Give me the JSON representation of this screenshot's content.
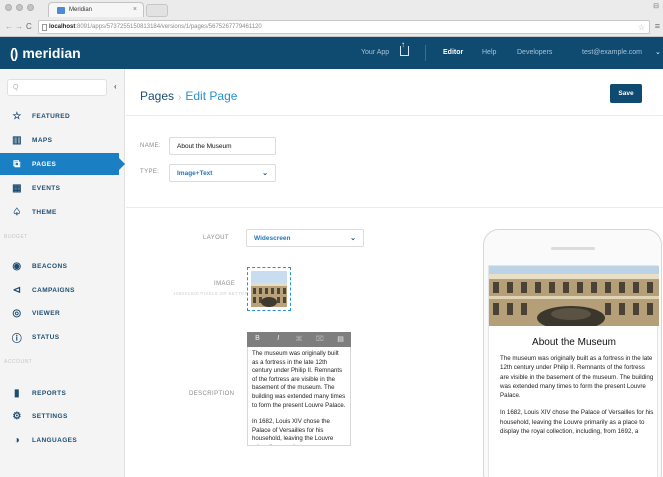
{
  "browser": {
    "tab_title": "Meridian",
    "url_host": "localhost",
    "url_path": ":8091/apps/5737255150813184/versions/1/pages/5675267779461120"
  },
  "header": {
    "brand": "meridian",
    "nav": {
      "your_app": "Your App",
      "editor": "Editor",
      "help": "Help",
      "developers": "Developers",
      "account": "test@example.com"
    }
  },
  "sidebar": {
    "search_placeholder": "Q",
    "items": [
      {
        "label": "FEATURED",
        "icon": "star-icon"
      },
      {
        "label": "MAPS",
        "icon": "map-icon"
      },
      {
        "label": "PAGES",
        "icon": "pages-icon"
      },
      {
        "label": "EVENTS",
        "icon": "calendar-icon"
      },
      {
        "label": "THEME",
        "icon": "paint-icon"
      }
    ],
    "section_budget": "BUDGET",
    "budget_items": [
      {
        "label": "BEACONS",
        "icon": "location-pin-icon"
      },
      {
        "label": "CAMPAIGNS",
        "icon": "megaphone-icon"
      },
      {
        "label": "VIEWER",
        "icon": "eye-icon"
      },
      {
        "label": "STATUS",
        "icon": "info-icon"
      }
    ],
    "section_account": "ACCOUNT",
    "account_items": [
      {
        "label": "REPORTS",
        "icon": "bar-chart-icon"
      },
      {
        "label": "SETTINGS",
        "icon": "gear-icon"
      },
      {
        "label": "LANGUAGES",
        "icon": "languages-icon"
      }
    ]
  },
  "page": {
    "breadcrumb_root": "Pages",
    "breadcrumb_sep": "›",
    "breadcrumb_current": "Edit Page",
    "save_label": "Save",
    "name_label": "NAME:",
    "name_value": "About the Museum",
    "type_label": "TYPE:",
    "type_value": "Image+Text",
    "layout_label": "LAYOUT",
    "layout_value": "Widescreen",
    "image_label": "IMAGE",
    "image_hint": "1080X1920 PIXELS OR BETTER",
    "description_label": "DESCRIPTION",
    "toolbar": [
      "B",
      "I",
      "⌘",
      "⌧",
      "▤"
    ],
    "description_paragraphs": [
      "The museum was originally built as a fortress in the late 12th century under Philip II. Remnants of the fortress are visible in the basement of the museum. The building was extended many times to form the present Louvre Palace.",
      "In 1682, Louis XIV chose the Palace of Versailles for his household, leaving the Louvre primarily as a place"
    ]
  },
  "preview": {
    "title": "About the Museum",
    "paragraphs": [
      "The museum was originally built as a fortress in the late 12th century under Philip II. Remnants of the fortress are visible in the basement of the museum. The building was extended many times to form the present Louvre Palace.",
      "In 1682, Louis XIV chose the Palace of Versailles for his household, leaving the Louvre primarily as a place to display the royal collection, including, from 1692, a"
    ]
  },
  "colors": {
    "header_bg": "#0f4a70",
    "accent": "#1b7fc4",
    "link": "#2590d2"
  }
}
